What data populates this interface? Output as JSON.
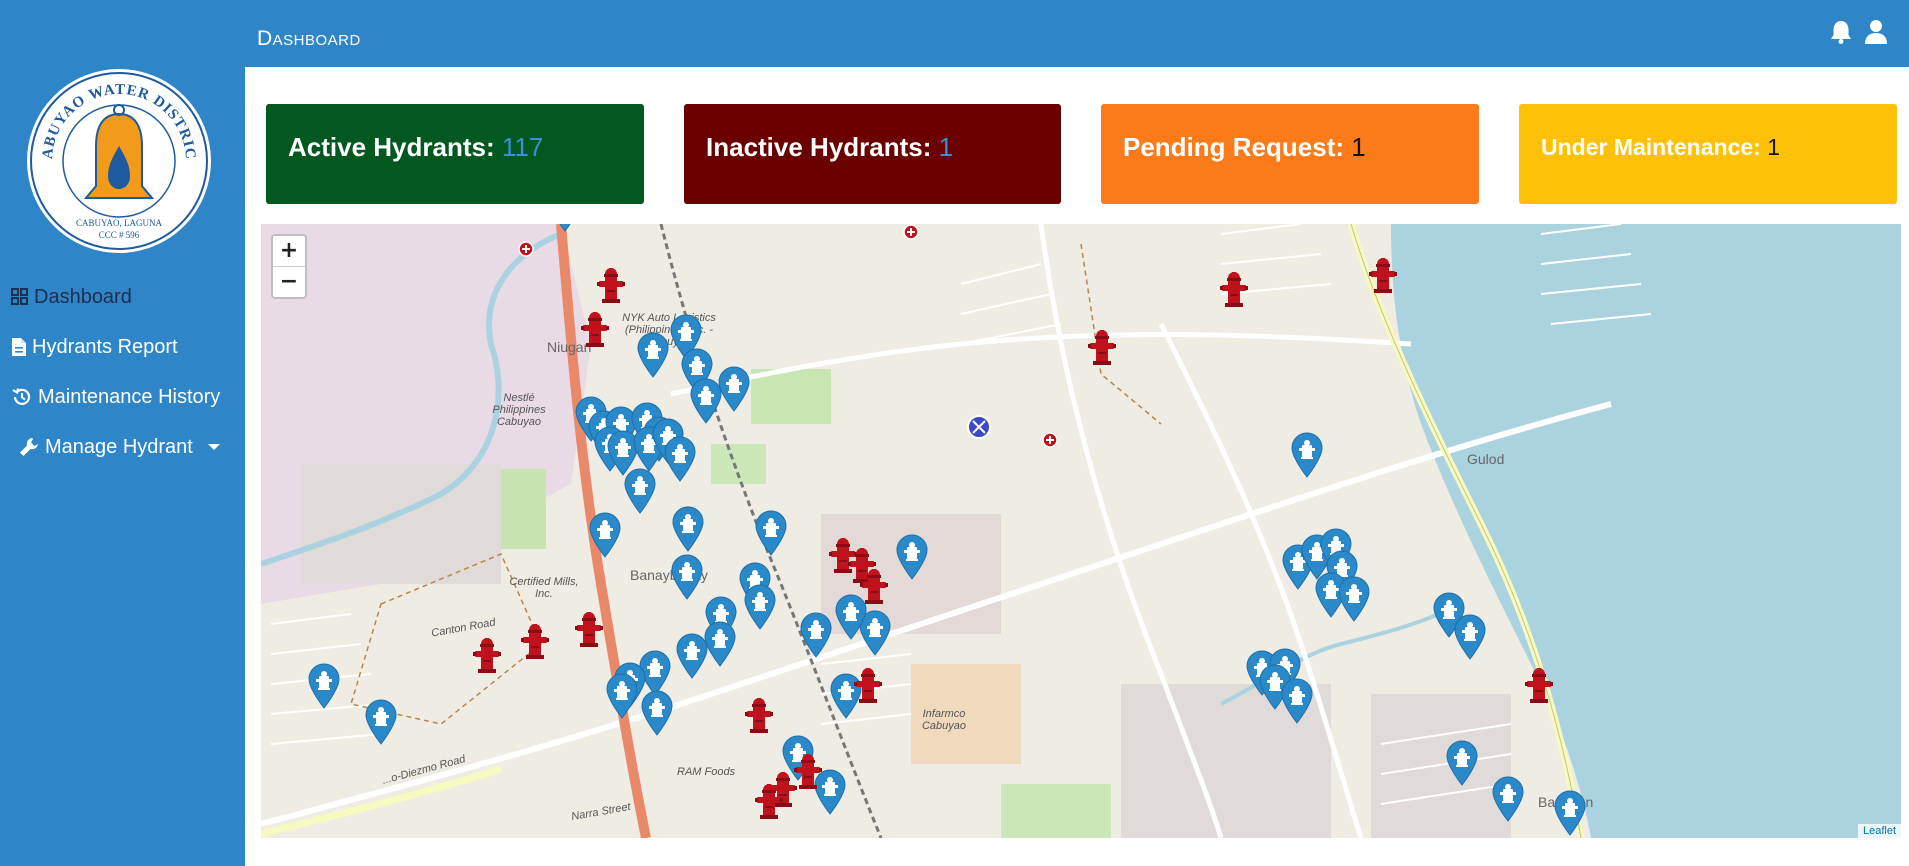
{
  "header": {
    "title": "Dashboard"
  },
  "logo": {
    "text_top": "CABUYAO WATER DISTRICT",
    "text_bottom_1": "CABUYAO, LAGUNA",
    "text_bottom_2": "CCC # 596"
  },
  "sidebar": {
    "items": [
      {
        "label": "Dashboard",
        "icon": "dashboard-icon"
      },
      {
        "label": "Hydrants Report",
        "icon": "document-icon"
      },
      {
        "label": "Maintenance History",
        "icon": "history-icon"
      },
      {
        "label": "Manage Hydrant",
        "icon": "wrench-icon",
        "has_dropdown": true
      }
    ]
  },
  "stats": [
    {
      "label": "Active Hydrants:",
      "value": "117",
      "color": "#02591f",
      "value_color": "#3a8fd6"
    },
    {
      "label": "Inactive Hydrants:",
      "value": "1",
      "color": "#6a0000",
      "value_color": "#3a8fd6"
    },
    {
      "label": "Pending Request:",
      "value": "1",
      "color": "#fb7a19",
      "value_color": "#111111"
    },
    {
      "label": "Under Maintenance:",
      "value": "1",
      "color": "#ffc107",
      "value_color": "#111111"
    }
  ],
  "map": {
    "zoom_in": "+",
    "zoom_out": "−",
    "attribution": "Leaflet",
    "labels": {
      "niugan": "Niugan",
      "banay": "Banaybanay",
      "gulod": "Gulod",
      "baclaran": "Baclaran",
      "nyk": "NYK Auto Logistics (Philippines) Inc. - Cabuyao",
      "nestle": "Nestlé Philippines Cabuyao",
      "certified": "Certified Mills, Inc.",
      "infarmco": "Infarmco Cabuyao",
      "ram": "RAM Foods",
      "dz": "...o-Diezmo Road",
      "canton": "Canton Road",
      "narra": "Narra Street"
    }
  },
  "colors": {
    "primary": "#2e86c8",
    "marker_blue": "#2a8ac9",
    "marker_red": "#c0121d"
  }
}
